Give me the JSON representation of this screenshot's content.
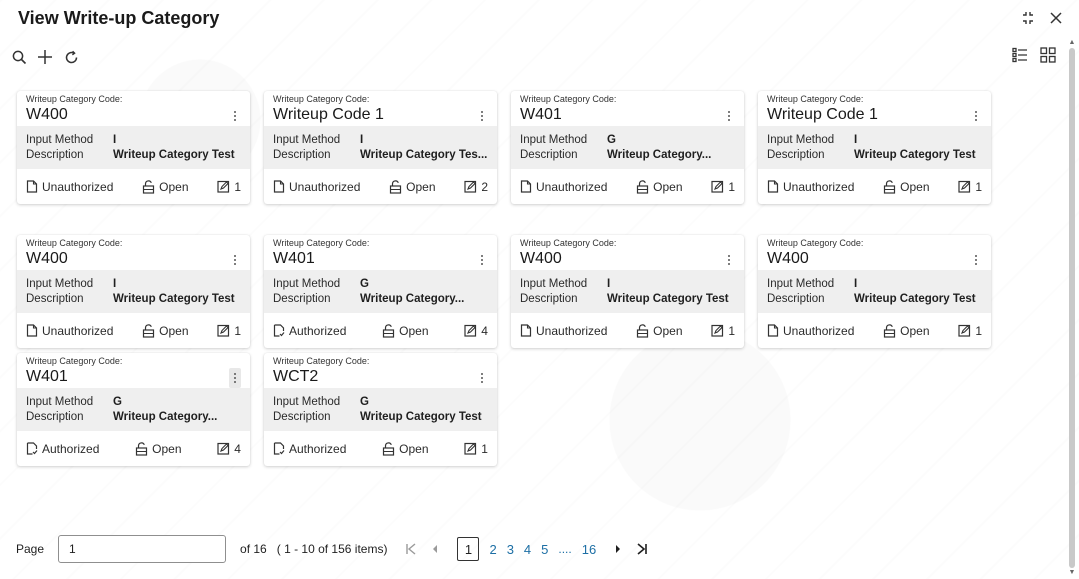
{
  "window": {
    "title": "View Write-up Category"
  },
  "labels": {
    "code_label": "Writeup Category Code:",
    "input_method": "Input Method",
    "description": "Description",
    "open": "Open"
  },
  "cards": [
    {
      "code": "W400",
      "input_method": "I",
      "description": "Writeup Category Test",
      "auth_status": "Unauthorized",
      "version": "1"
    },
    {
      "code": "Writeup Code 1",
      "input_method": "I",
      "description": "Writeup Category Tes...",
      "auth_status": "Unauthorized",
      "version": "2"
    },
    {
      "code": "W401",
      "input_method": "G",
      "description": "Writeup Category...",
      "auth_status": "Unauthorized",
      "version": "1"
    },
    {
      "code": "Writeup Code 1",
      "input_method": "I",
      "description": "Writeup Category Test",
      "auth_status": "Unauthorized",
      "version": "1"
    },
    {
      "code": "W400",
      "input_method": "I",
      "description": "Writeup Category Test",
      "auth_status": "Unauthorized",
      "version": "1"
    },
    {
      "code": "W401",
      "input_method": "G",
      "description": "Writeup Category...",
      "auth_status": "Authorized",
      "version": "4"
    },
    {
      "code": "W400",
      "input_method": "I",
      "description": "Writeup Category Test",
      "auth_status": "Unauthorized",
      "version": "1"
    },
    {
      "code": "W400",
      "input_method": "I",
      "description": "Writeup Category Test",
      "auth_status": "Unauthorized",
      "version": "1"
    },
    {
      "code": "W401",
      "input_method": "G",
      "description": "Writeup Category...",
      "auth_status": "Authorized",
      "version": "4"
    },
    {
      "code": "WCT2",
      "input_method": "G",
      "description": "Writeup Category Test",
      "auth_status": "Authorized",
      "version": "1"
    }
  ],
  "pagination": {
    "page_label": "Page",
    "page_value": "1",
    "of_text": "of 16",
    "range_text": "( 1 - 10 of 156 items)",
    "pages": [
      "2",
      "3",
      "4",
      "5"
    ],
    "current": "1",
    "ellipsis": "....",
    "last": "16"
  },
  "colors": {
    "link": "#1d6fa5",
    "card_body": "#efefef"
  }
}
